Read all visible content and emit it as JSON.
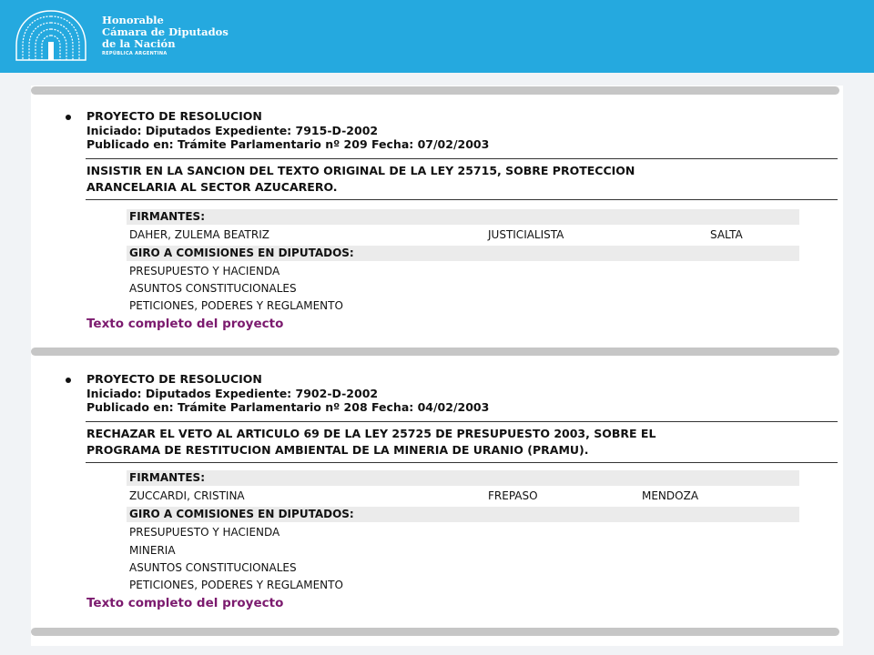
{
  "header": {
    "org_line1": "Honorable",
    "org_line2": "Cámara de Diputados",
    "org_line3": "de la Nación",
    "org_sub": "REPÚBLICA ARGENTINA",
    "background": "#25a9df"
  },
  "link_color": "#7b1a6e",
  "records": [
    {
      "type": "PROYECTO DE RESOLUCION",
      "iniciado": "Iniciado: Diputados Expediente: 7915-D-2002",
      "publicado": "Publicado en: Trámite Parlamentario nº 209 Fecha: 07/02/2003",
      "title_lines": [
        "INSISTIR EN LA SANCION DEL TEXTO ORIGINAL DE LA LEY 25715, SOBRE PROTECCION",
        "ARANCELARIA AL SECTOR AZUCARERO."
      ],
      "firmantes_label": "FIRMANTES:",
      "firmantes": [
        {
          "name": "DAHER, ZULEMA BEATRIZ",
          "bloque": "JUSTICIALISTA",
          "provincia": "SALTA"
        }
      ],
      "giro_label": "GIRO A COMISIONES EN DIPUTADOS:",
      "comisiones": [
        "PRESUPUESTO Y HACIENDA",
        "ASUNTOS CONSTITUCIONALES",
        "PETICIONES, PODERES Y REGLAMENTO"
      ],
      "link": "Texto completo del proyecto"
    },
    {
      "type": "PROYECTO DE RESOLUCION",
      "iniciado": "Iniciado: Diputados Expediente: 7902-D-2002",
      "publicado": "Publicado en: Trámite Parlamentario nº 208 Fecha: 04/02/2003",
      "title_lines": [
        "RECHAZAR EL VETO AL ARTICULO 69 DE LA LEY 25725 DE PRESUPUESTO 2003, SOBRE EL",
        "PROGRAMA DE RESTITUCION AMBIENTAL DE LA MINERIA DE URANIO (PRAMU)."
      ],
      "firmantes_label": "FIRMANTES:",
      "firmantes": [
        {
          "name": "ZUCCARDI, CRISTINA",
          "bloque": "FREPASO",
          "provincia": "MENDOZA"
        }
      ],
      "giro_label": "GIRO A COMISIONES EN DIPUTADOS:",
      "comisiones": [
        "PRESUPUESTO Y HACIENDA",
        "MINERIA",
        "ASUNTOS CONSTITUCIONALES",
        "PETICIONES, PODERES Y REGLAMENTO"
      ],
      "link": "Texto completo del proyecto"
    }
  ]
}
